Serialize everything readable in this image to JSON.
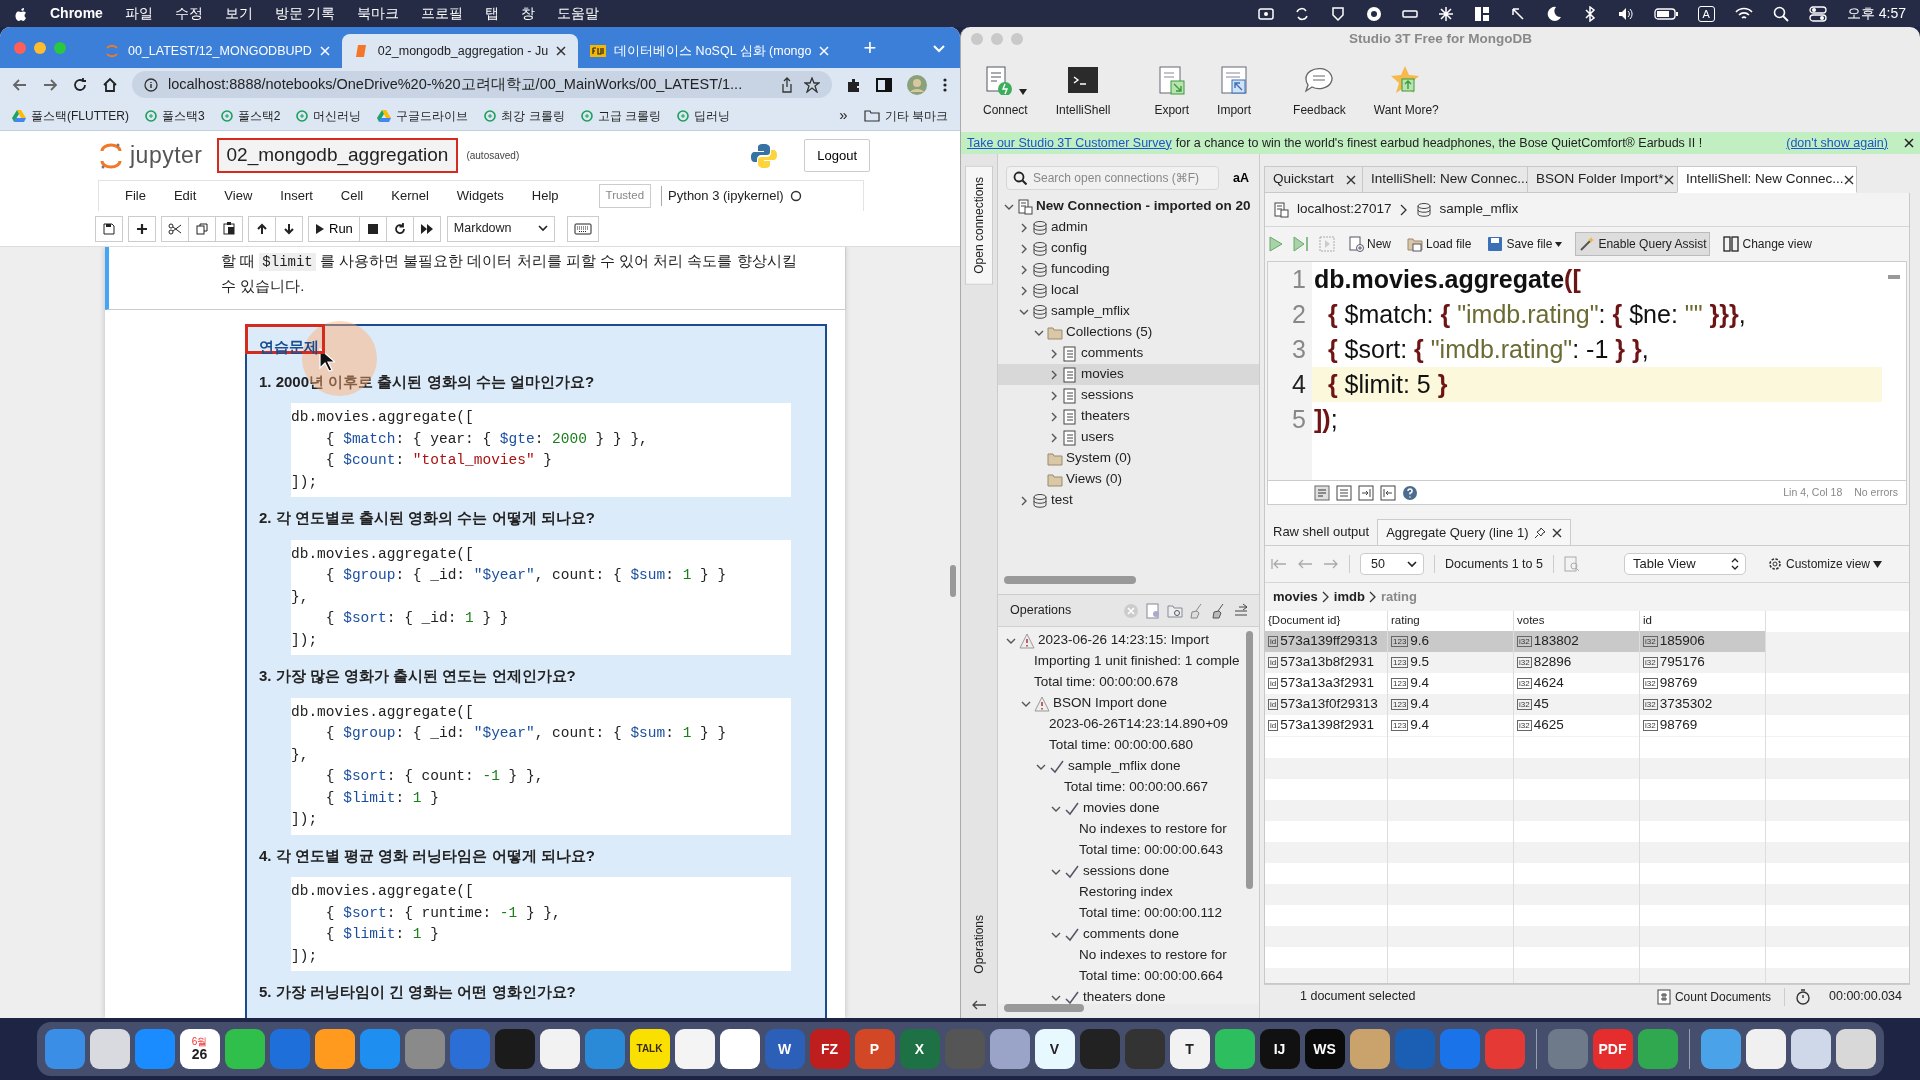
{
  "menubar": {
    "app": "Chrome",
    "menus": [
      "파일",
      "수정",
      "보기",
      "방문 기록",
      "북마크",
      "프로필",
      "탭",
      "창",
      "도움말"
    ],
    "input_indicator": "A",
    "clock": "오후 4:57"
  },
  "browser": {
    "tabs": [
      {
        "title": "00_LATEST/12_MONGODBUPD",
        "selected": false
      },
      {
        "title": "02_mongodb_aggregation - Ju",
        "selected": true
      },
      {
        "title": "데이터베이스 NoSQL 심화 (mongo",
        "selected": false
      }
    ],
    "new_tab": "+",
    "url": "localhost:8888/notebooks/OneDrive%20-%20고려대학교/00_MainWorks/00_LATEST/1...",
    "bookmarks": [
      "풀스택(FLUTTER)",
      "풀스택3",
      "풀스택2",
      "머신러닝",
      "구글드라이브",
      "최강 크롤링",
      "고급 크롤링",
      "딥러닝"
    ],
    "more_bookmarks": "»",
    "other_bookmarks": "기타 북마크"
  },
  "jupyter": {
    "logo": "jupyter",
    "notebook_title": "02_mongodb_aggregation",
    "save_status": "(autosaved)",
    "logout": "Logout",
    "menus": [
      "File",
      "Edit",
      "View",
      "Insert",
      "Cell",
      "Kernel",
      "Widgets",
      "Help"
    ],
    "trusted": "Trusted",
    "kernel": "Python 3 (ipykernel)",
    "run": "Run",
    "cell_type": "Markdown",
    "prev_cell": {
      "before": "할 때 ",
      "code": "$limit",
      "after": " 를 사용하면 불필요한 데이터 처리를 피할 수 있어 처리 속도를 향상시킬 수 있습니다."
    },
    "exercise": {
      "heading": "연습문제",
      "questions": [
        {
          "text": "1. 2000년 이후로 출시된 영화의 수는 얼마인가요?",
          "code": [
            "db.movies.aggregate([",
            "    { $match: { year: { $gte: 2000 } } },",
            "    { $count: \"total_movies\" }",
            "]);"
          ]
        },
        {
          "text": "2. 각 연도별로 출시된 영화의 수는 어떻게 되나요?",
          "code": [
            "db.movies.aggregate([",
            "    { $group: { _id: \"$year\", count: { $sum: 1 } }",
            "},",
            "    { $sort: { _id: 1 } }",
            "]);"
          ]
        },
        {
          "text": "3. 가장 많은 영화가 출시된 연도는 언제인가요?",
          "code": [
            "db.movies.aggregate([",
            "    { $group: { _id: \"$year\", count: { $sum: 1 } }",
            "},",
            "    { $sort: { count: -1 } },",
            "    { $limit: 1 }",
            "]);"
          ]
        },
        {
          "text": "4. 각 연도별 평균 영화 러닝타임은 어떻게 되나요?",
          "code": [
            "db.movies.aggregate([",
            "    { $sort: { runtime: -1 } },",
            "    { $limit: 1 }",
            "]);"
          ]
        }
      ],
      "next_question": "5. 가장 러닝타임이 긴 영화는 어떤 영화인가요?"
    }
  },
  "studio": {
    "title": "Studio 3T Free for MongoDB",
    "toolbar": [
      {
        "label": "Connect",
        "kind": "connect"
      },
      {
        "label": "IntelliShell",
        "kind": "shell"
      },
      {
        "label": "Export",
        "kind": "export"
      },
      {
        "label": "Import",
        "kind": "import"
      },
      {
        "label": "Feedback",
        "kind": "feedback"
      },
      {
        "label": "Want More?",
        "kind": "star"
      }
    ],
    "survey": {
      "link": "Take our Studio 3T Customer Survey",
      "text": "for a chance to win the world's finest earbud headphones, the Bose QuietComfort® Earbuds II !",
      "dismiss": "(don't show again)"
    },
    "side_tabs": [
      {
        "label": "Open connections",
        "selected": true
      },
      {
        "label": "Operations",
        "selected": false
      }
    ],
    "search": {
      "placeholder": "Search open connections (⌘F)"
    },
    "font_toggle": "aA",
    "tree": [
      {
        "label": "New Connection - imported on 20",
        "kind": "server",
        "expanded": true,
        "selected": false,
        "children": [
          {
            "label": "admin",
            "kind": "database",
            "expanded": false,
            "selected": false
          },
          {
            "label": "config",
            "kind": "database",
            "expanded": false,
            "selected": false
          },
          {
            "label": "funcoding",
            "kind": "database",
            "expanded": false,
            "selected": false
          },
          {
            "label": "local",
            "kind": "database",
            "expanded": false,
            "selected": false
          },
          {
            "label": "sample_mflix",
            "kind": "database",
            "expanded": true,
            "selected": false,
            "children": [
              {
                "label": "Collections (5)",
                "kind": "folder",
                "expanded": true,
                "selected": false,
                "children": [
                  {
                    "label": "comments",
                    "kind": "collection",
                    "expanded": false,
                    "selected": false
                  },
                  {
                    "label": "movies",
                    "kind": "collection",
                    "expanded": false,
                    "selected": true
                  },
                  {
                    "label": "sessions",
                    "kind": "collection",
                    "expanded": false,
                    "selected": false
                  },
                  {
                    "label": "theaters",
                    "kind": "collection",
                    "expanded": false,
                    "selected": false
                  },
                  {
                    "label": "users",
                    "kind": "collection",
                    "expanded": false,
                    "selected": false
                  }
                ]
              },
              {
                "label": "System (0)",
                "kind": "folder",
                "selected": false
              },
              {
                "label": "Views (0)",
                "kind": "folder",
                "selected": false
              }
            ]
          },
          {
            "label": "test",
            "kind": "database",
            "expanded": false,
            "selected": false
          }
        ]
      }
    ],
    "operations": {
      "title": "Operations",
      "items": [
        {
          "text": "2023-06-26 14:23:15:  Import",
          "kind": "warning",
          "expanded": true,
          "children": [
            {
              "text": "Importing 1 unit finished: 1 comple"
            },
            {
              "text": "Total time: 00:00:00.678"
            },
            {
              "text": "BSON Import done",
              "kind": "warning",
              "expanded": true,
              "children": [
                {
                  "text": "2023-06-26T14:23:14.890+09"
                },
                {
                  "text": "Total time: 00:00:00.680"
                },
                {
                  "text": "sample_mflix done",
                  "kind": "done",
                  "expanded": true,
                  "children": [
                    {
                      "text": "Total time: 00:00:00.667"
                    },
                    {
                      "text": "movies done",
                      "kind": "done",
                      "expanded": true,
                      "children": [
                        {
                          "text": "No indexes to restore for"
                        },
                        {
                          "text": "Total time: 00:00:00.643"
                        }
                      ]
                    },
                    {
                      "text": "sessions done",
                      "kind": "done",
                      "expanded": true,
                      "children": [
                        {
                          "text": "Restoring index"
                        },
                        {
                          "text": "Total time: 00:00:00.112"
                        }
                      ]
                    },
                    {
                      "text": "comments done",
                      "kind": "done",
                      "expanded": true,
                      "children": [
                        {
                          "text": "No indexes to restore for"
                        },
                        {
                          "text": "Total time: 00:00:00.664"
                        }
                      ]
                    },
                    {
                      "text": "theaters done",
                      "kind": "done",
                      "expanded": true
                    }
                  ]
                }
              ]
            }
          ]
        }
      ]
    },
    "tabs": [
      {
        "label": "Quickstart",
        "selected": false
      },
      {
        "label": "IntelliShell: New Connec...",
        "selected": false
      },
      {
        "label": "BSON Folder Import*",
        "selected": false
      },
      {
        "label": "IntelliShell: New Connec...",
        "selected": true
      }
    ],
    "breadcrumb": [
      "localhost:27017",
      "sample_mflix"
    ],
    "editor_toolbar": [
      {
        "label": "New",
        "kind": "new"
      },
      {
        "label": "Load file",
        "kind": "load"
      },
      {
        "label": "Save file",
        "kind": "save"
      },
      {
        "label": "Enable Query Assist",
        "kind": "assist"
      },
      {
        "label": "Change view",
        "kind": "view"
      }
    ],
    "editor": {
      "lines": [
        {
          "number": "1",
          "text": "db.movies.aggregate([",
          "current": false
        },
        {
          "number": "2",
          "text": "  { $match: { \"imdb.rating\": { $ne: \"\" }}},",
          "current": false
        },
        {
          "number": "3",
          "text": "  { $sort: { \"imdb.rating\": -1 } },",
          "current": false
        },
        {
          "number": "4",
          "text": "  { $limit: 5 }",
          "current": true
        },
        {
          "number": "5",
          "text": "]);",
          "current": false
        }
      ],
      "position": "Lin 4, Col 18",
      "errors": "No errors"
    },
    "result_tabs": [
      {
        "label": "Raw shell output",
        "selected": false
      },
      {
        "label": "Aggregate Query (line 1)",
        "selected": true
      }
    ],
    "page_size": "50",
    "range": "Documents 1 to 5",
    "view": "Table View",
    "customize": "Customize view",
    "path": [
      {
        "label": "movies",
        "current": false
      },
      {
        "label": "imdb",
        "current": false
      },
      {
        "label": "rating",
        "current": true
      }
    ],
    "table": {
      "columns": [
        "{Document id}",
        "rating",
        "votes",
        "id"
      ],
      "rows": [
        {
          "selected": true,
          "cells": [
            {
              "type": "id",
              "value": "573a139ff29313"
            },
            {
              "type": "123",
              "value": "9.6"
            },
            {
              "type": "i32",
              "value": "183802"
            },
            {
              "type": "i32",
              "value": "185906"
            }
          ]
        },
        {
          "selected": false,
          "cells": [
            {
              "type": "id",
              "value": "573a13b8f2931"
            },
            {
              "type": "123",
              "value": "9.5"
            },
            {
              "type": "i32",
              "value": "82896"
            },
            {
              "type": "i32",
              "value": "795176"
            }
          ]
        },
        {
          "selected": false,
          "cells": [
            {
              "type": "id",
              "value": "573a13a3f2931"
            },
            {
              "type": "123",
              "value": "9.4"
            },
            {
              "type": "i32",
              "value": "4624"
            },
            {
              "type": "i32",
              "value": "98769"
            }
          ]
        },
        {
          "selected": false,
          "cells": [
            {
              "type": "id",
              "value": "573a13f0f29313"
            },
            {
              "type": "123",
              "value": "9.4"
            },
            {
              "type": "i32",
              "value": "45"
            },
            {
              "type": "i32",
              "value": "3735302"
            }
          ]
        },
        {
          "selected": false,
          "cells": [
            {
              "type": "id",
              "value": "573a1398f2931"
            },
            {
              "type": "123",
              "value": "9.4"
            },
            {
              "type": "i32",
              "value": "4625"
            },
            {
              "type": "i32",
              "value": "98769"
            }
          ]
        }
      ]
    },
    "status_bar": {
      "selection": "1 document selected",
      "count": "Count Documents",
      "elapsed": "00:00:00.034"
    }
  },
  "dock": [
    [
      {
        "color": "#3a8ee6"
      },
      {
        "color": "#d9d9e0"
      },
      {
        "color": "#1a8cff"
      },
      {
        "color": "#ffffff",
        "glyph": "26",
        "caption": "6월"
      },
      {
        "color": "#2fbf4a"
      },
      {
        "color": "#1e6fd9"
      },
      {
        "color": "#ff9a1f"
      },
      {
        "color": "#1f8ef1"
      },
      {
        "color": "#8a8a8a"
      },
      {
        "color": "#2b6fd6"
      },
      {
        "color": "#1b1b1b"
      },
      {
        "color": "#f2f2f2"
      },
      {
        "color": "#2a8ad8"
      },
      {
        "color": "#f9e000",
        "glyph": "TALK"
      },
      {
        "color": "#f4f4f4"
      },
      {
        "color": "#ffffff"
      },
      {
        "color": "#2b5fb8",
        "glyph": "W"
      },
      {
        "color": "#bf1e1e",
        "glyph": "FZ"
      },
      {
        "color": "#d24726",
        "glyph": "P"
      },
      {
        "color": "#1e7145",
        "glyph": "X"
      },
      {
        "color": "#555555"
      },
      {
        "color": "#9aa4c8"
      },
      {
        "color": "#e8f8ff",
        "glyph": "V"
      },
      {
        "color": "#222222"
      },
      {
        "color": "#333333"
      },
      {
        "color": "#f2f2f2",
        "glyph": "T"
      },
      {
        "color": "#2dbe60"
      },
      {
        "color": "#111111",
        "glyph": "IJ"
      },
      {
        "color": "#0b0b0b",
        "glyph": "WS"
      },
      {
        "color": "#c9a36b"
      },
      {
        "color": "#1a5fb4"
      },
      {
        "color": "#1a73e8"
      },
      {
        "color": "#e53935"
      }
    ],
    [
      {
        "color": "#6e7a8a"
      },
      {
        "color": "#e52d2d",
        "glyph": "PDF"
      },
      {
        "color": "#2fa84f"
      }
    ],
    [
      {
        "color": "#4aa3e8"
      },
      {
        "color": "#f0f0f0"
      },
      {
        "color": "#cfd8e8"
      },
      {
        "color": "#d8d8d8"
      }
    ]
  ]
}
